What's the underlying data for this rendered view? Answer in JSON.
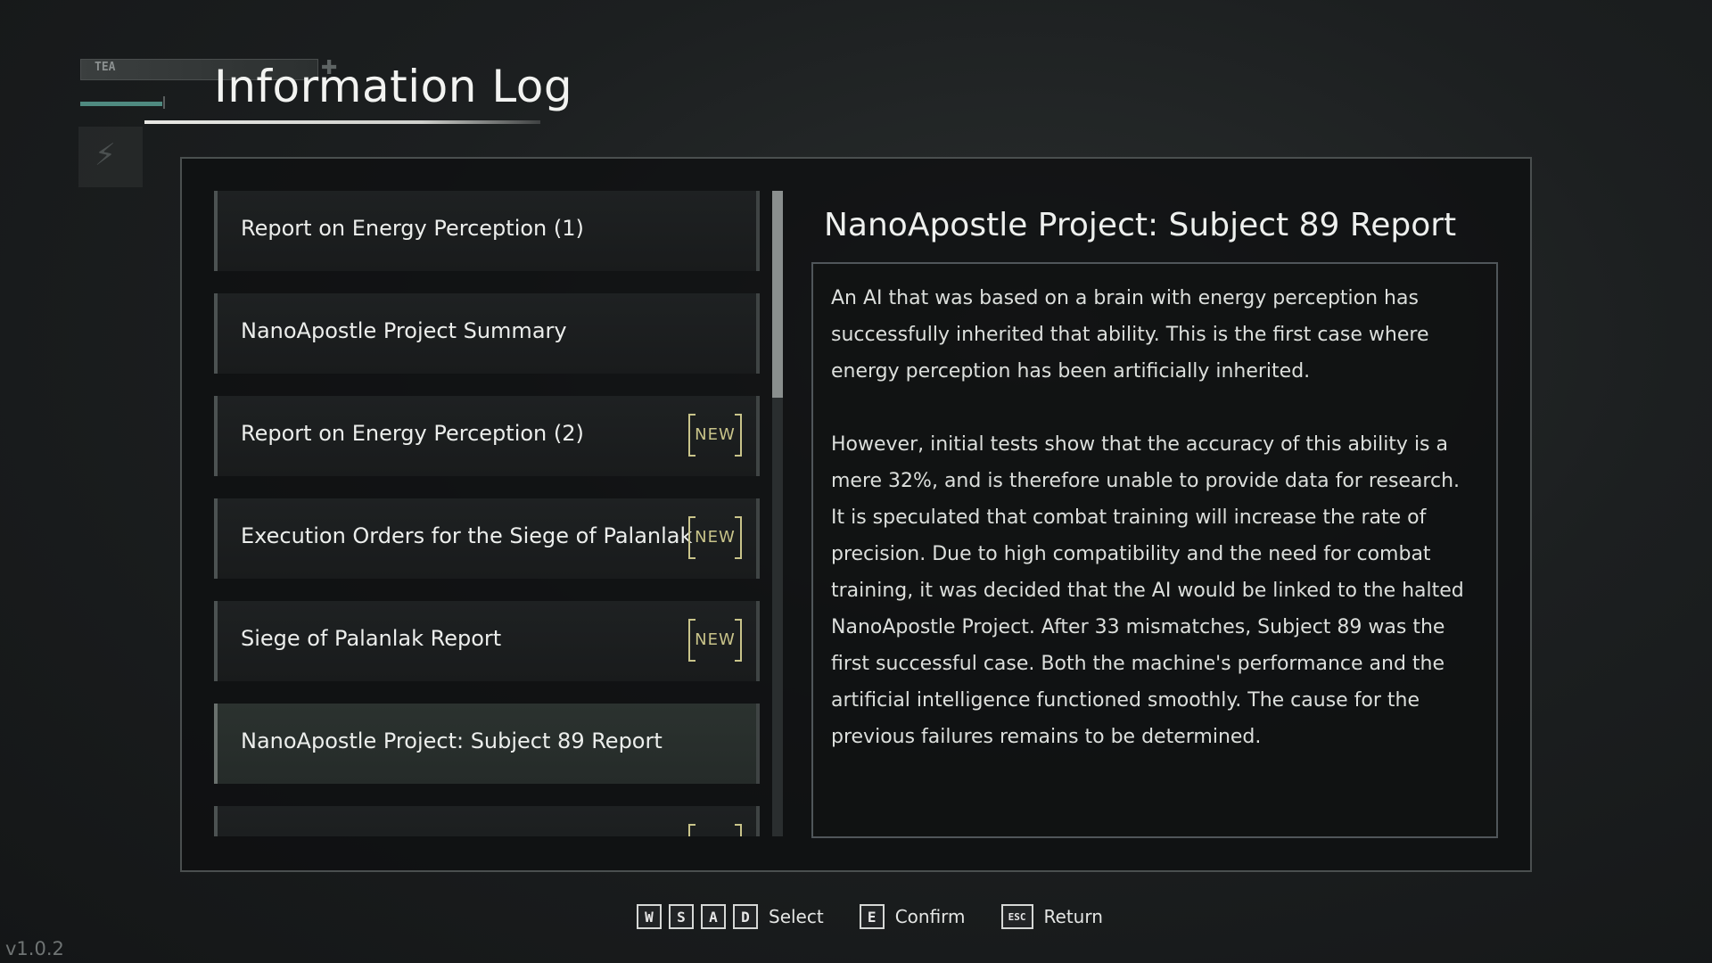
{
  "header": {
    "title": "Information Log",
    "hud_tag": "TEA"
  },
  "entries": [
    {
      "label": "Report on Energy Perception (1)",
      "new": false,
      "selected": false
    },
    {
      "label": "NanoApostle Project Summary",
      "new": false,
      "selected": false
    },
    {
      "label": "Report on Energy Perception (2)",
      "new": true,
      "selected": false
    },
    {
      "label": "Execution Orders for the Siege of Palanlak",
      "new": true,
      "selected": false
    },
    {
      "label": "Siege of Palanlak Report",
      "new": true,
      "selected": false
    },
    {
      "label": "NanoApostle Project: Subject 89 Report",
      "new": false,
      "selected": true
    },
    {
      "label": "",
      "new": true,
      "selected": false
    }
  ],
  "new_badge_label": "NEW",
  "detail": {
    "title": "NanoApostle Project: Subject 89 Report",
    "paragraphs": [
      "An AI that was based on a brain with energy perception has successfully inherited that ability. This is the first case where energy perception has been artificially inherited.",
      "However, initial tests show that the accuracy of this ability is a mere 32%, and is therefore unable to provide data for research. It is speculated that combat training will increase the rate of precision. Due to high compatibility and the need for combat training, it was decided that the AI would be linked to the halted NanoApostle Project. After 33 mismatches, Subject 89 was the first successful case. Both the machine's performance and the artificial intelligence functioned smoothly. The cause for the previous failures remains to be determined."
    ]
  },
  "controls": {
    "keys_select": [
      "W",
      "S",
      "A",
      "D"
    ],
    "select_label": "Select",
    "key_confirm": "E",
    "confirm_label": "Confirm",
    "key_return": "ESC",
    "return_label": "Return"
  },
  "version": "v1.0.2",
  "colors": {
    "new_badge": "#c9c48a",
    "selected_entry": "#2b322f",
    "accent_bar": "#4f8a80"
  }
}
